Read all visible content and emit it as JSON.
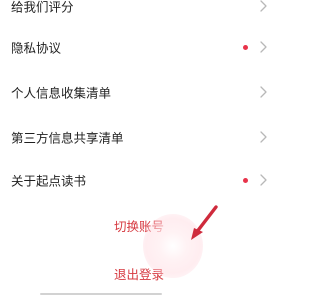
{
  "settings": {
    "items": [
      {
        "label": "给我们评分",
        "has_dot": false
      },
      {
        "label": "隐私协议",
        "has_dot": true
      },
      {
        "label": "个人信息收集清单",
        "has_dot": false
      },
      {
        "label": "第三方信息共享清单",
        "has_dot": false
      },
      {
        "label": "关于起点读书",
        "has_dot": true
      }
    ]
  },
  "actions": {
    "switch_account_label": "切换账号",
    "logout_label": "退出登录"
  },
  "colors": {
    "accent_red": "#d6383f",
    "dot_red": "#e8334a",
    "chevron_gray": "#b8b8b8",
    "text_dark": "#1f1f1f"
  },
  "icons": {
    "chevron": "chevron-right-icon",
    "dot": "new-indicator-dot"
  }
}
